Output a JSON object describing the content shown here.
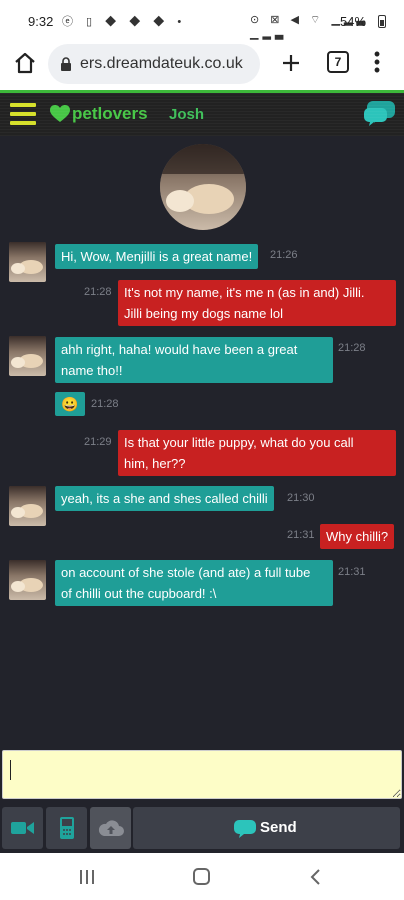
{
  "status_bar": {
    "time": "9:32",
    "left_icons": "ⓔ ▯ ◆ ◆ ◆ •",
    "right_icons": "⊙ ⊠ ◀ ⌔ ▁▂▃ ▁▂▃",
    "battery": "54%"
  },
  "browser": {
    "url": "ers.dreamdateuk.co.uk",
    "tab_count": "7"
  },
  "app_header": {
    "brand": "petlovers",
    "user_name": "Josh"
  },
  "messages": [
    {
      "direction": "in",
      "text_lines": [
        "Hi, Wow, Menjilli is a great name!"
      ],
      "time": "21:26"
    },
    {
      "direction": "out",
      "text_lines": [
        "It's not my name, it's me n (as in and) Jilli.",
        "Jilli being my dogs name lol"
      ],
      "time": "21:28"
    },
    {
      "direction": "in",
      "text_lines": [
        "ahh right, haha! would have been a great",
        "name tho!!"
      ],
      "time": "21:28"
    },
    {
      "direction": "in",
      "emoji": "😀",
      "time": "21:28"
    },
    {
      "direction": "out",
      "text_lines": [
        "Is that your little puppy, what do you call",
        "him, her??"
      ],
      "time": "21:29"
    },
    {
      "direction": "in",
      "text_lines": [
        "yeah, its a she and shes called chilli"
      ],
      "time": "21:30"
    },
    {
      "direction": "out",
      "text_lines": [
        "Why chilli?"
      ],
      "time": "21:31"
    },
    {
      "direction": "in",
      "text_lines": [
        "on account of she stole (and ate) a full tube",
        "of chilli out the cupboard! :\\"
      ],
      "time": "21:31"
    }
  ],
  "composer": {
    "input_value": "",
    "send_label": "Send"
  },
  "colors": {
    "incoming_bubble": "#1f9e97",
    "outgoing_bubble": "#c82121",
    "chat_bg": "#22232b",
    "brand_green": "#47c746",
    "input_bg": "#fdfdc7"
  },
  "icons": {
    "header": [
      "hamburger-menu-icon",
      "heart-icon",
      "chat-bubble-icon"
    ],
    "toolbar": [
      "video-camera-icon",
      "phone-icon",
      "cloud-upload-icon",
      "send-chat-icon"
    ]
  }
}
